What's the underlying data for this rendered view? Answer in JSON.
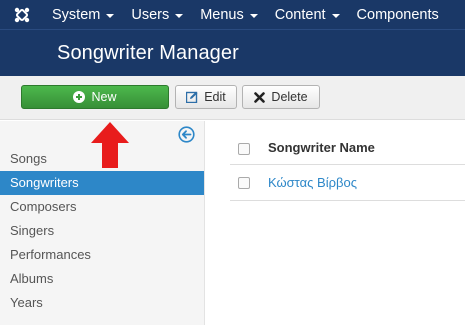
{
  "nav": {
    "menus": [
      {
        "label": "System"
      },
      {
        "label": "Users"
      },
      {
        "label": "Menus"
      },
      {
        "label": "Content"
      },
      {
        "label": "Components"
      }
    ]
  },
  "header": {
    "title": "Songwriter Manager"
  },
  "toolbar": {
    "new_label": "New",
    "edit_label": "Edit",
    "delete_label": "Delete"
  },
  "sidebar": {
    "items": [
      {
        "label": "Songs"
      },
      {
        "label": "Songwriters"
      },
      {
        "label": "Composers"
      },
      {
        "label": "Singers"
      },
      {
        "label": "Performances"
      },
      {
        "label": "Albums"
      },
      {
        "label": "Years"
      }
    ],
    "active_index": 1
  },
  "table": {
    "column_header": "Songwriter Name",
    "rows": [
      {
        "name": "Κώστας Βίρβος"
      }
    ]
  },
  "colors": {
    "nav_bg": "#1a3867",
    "accent": "#2d87c8",
    "new_button": "#46a546",
    "arrow": "#e81c1c"
  }
}
